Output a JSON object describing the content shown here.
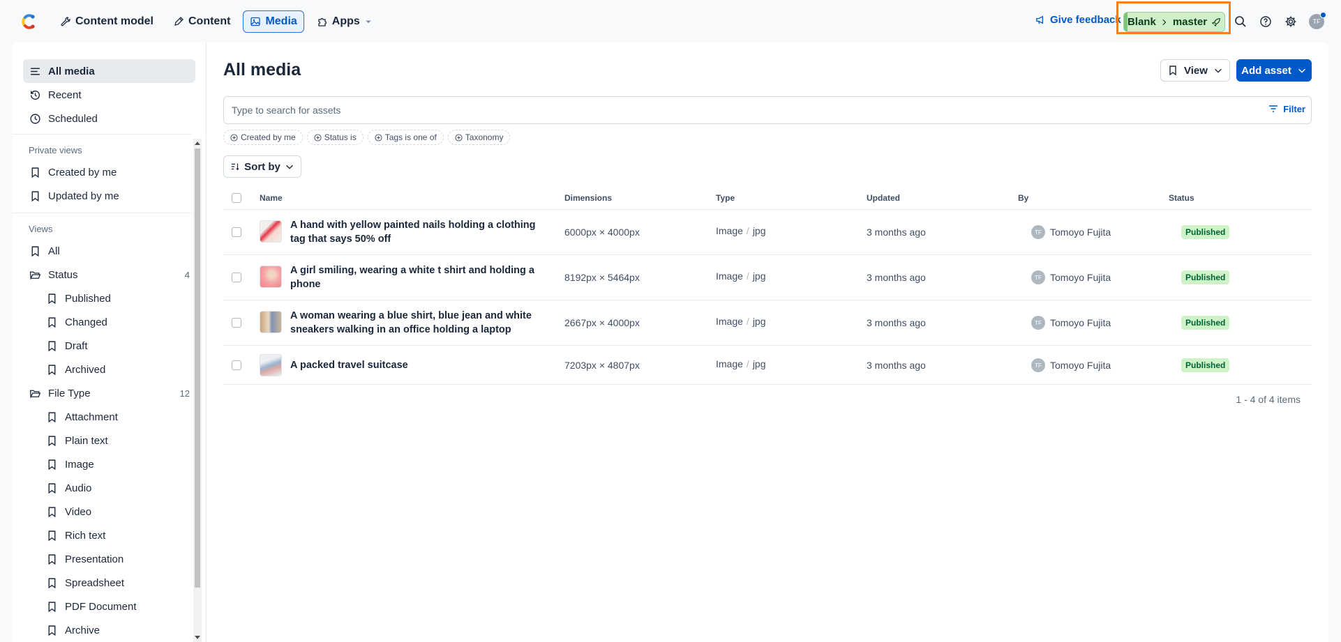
{
  "nav": {
    "items": [
      {
        "label": "Content model",
        "icon": "wrench-icon"
      },
      {
        "label": "Content",
        "icon": "pen-icon"
      },
      {
        "label": "Media",
        "icon": "image-icon"
      },
      {
        "label": "Apps",
        "icon": "puzzle-icon"
      }
    ],
    "feedback": "Give feedback",
    "env_space": "Blank",
    "env_name": "master",
    "avatar_initials": "TF"
  },
  "sidebar": {
    "top": [
      {
        "label": "All media",
        "icon": "list-icon"
      },
      {
        "label": "Recent",
        "icon": "history-icon"
      },
      {
        "label": "Scheduled",
        "icon": "clock-icon"
      }
    ],
    "private_heading": "Private views",
    "private": [
      {
        "label": "Created by me"
      },
      {
        "label": "Updated by me"
      }
    ],
    "views_heading": "Views",
    "views_all": "All",
    "status_folder": "Status",
    "status_count": "4",
    "status_items": [
      "Published",
      "Changed",
      "Draft",
      "Archived"
    ],
    "filetype_folder": "File Type",
    "filetype_count": "12",
    "filetype_items": [
      "Attachment",
      "Plain text",
      "Image",
      "Audio",
      "Video",
      "Rich text",
      "Presentation",
      "Spreadsheet",
      "PDF Document",
      "Archive"
    ]
  },
  "main": {
    "title": "All media",
    "view_label": "View",
    "add_label": "Add asset",
    "search_placeholder": "Type to search for assets",
    "filter_label": "Filter",
    "chips": [
      "Created by me",
      "Status is",
      "Tags is one of",
      "Taxonomy"
    ],
    "sort_label": "Sort by",
    "columns": [
      "Name",
      "Dimensions",
      "Type",
      "Updated",
      "By",
      "Status"
    ],
    "rows": [
      {
        "name": "A hand with yellow painted nails holding a clothing tag that says 50% off",
        "dimensions": "6000px × 4000px",
        "type": "Image",
        "ext": "jpg",
        "updated": "3 months ago",
        "by": "Tomoyo Fujita",
        "by_initials": "TF",
        "status": "Published"
      },
      {
        "name": "A girl smiling, wearing a white t shirt and holding a phone",
        "dimensions": "8192px × 5464px",
        "type": "Image",
        "ext": "jpg",
        "updated": "3 months ago",
        "by": "Tomoyo Fujita",
        "by_initials": "TF",
        "status": "Published"
      },
      {
        "name": "A woman wearing a blue shirt, blue jean and white sneakers walking in an office holding a laptop",
        "dimensions": "2667px × 4000px",
        "type": "Image",
        "ext": "jpg",
        "updated": "3 months ago",
        "by": "Tomoyo Fujita",
        "by_initials": "TF",
        "status": "Published"
      },
      {
        "name": "A packed travel suitcase",
        "dimensions": "7203px × 4807px",
        "type": "Image",
        "ext": "jpg",
        "updated": "3 months ago",
        "by": "Tomoyo Fujita",
        "by_initials": "TF",
        "status": "Published"
      }
    ],
    "pagination": "1 - 4 of 4 items"
  },
  "colors": {
    "accent": "#0059c8",
    "published_bg": "#cdf3c6",
    "env_bg": "#cfeec9",
    "highlight": "#f4801f"
  }
}
